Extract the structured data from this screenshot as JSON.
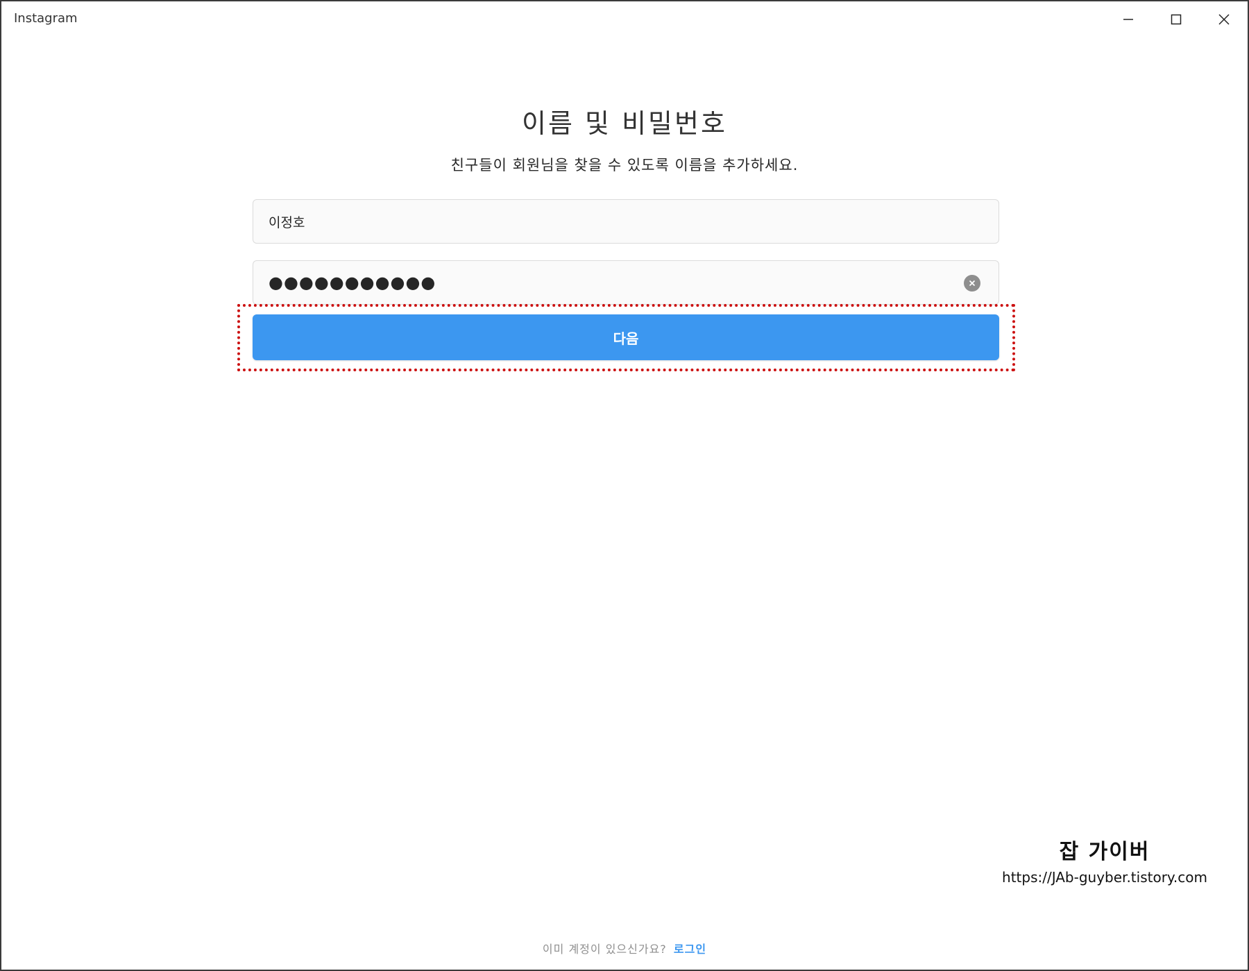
{
  "window": {
    "title": "Instagram",
    "controls": {
      "minimize": "minimize-icon",
      "maximize": "maximize-icon",
      "close": "close-icon"
    }
  },
  "form": {
    "heading": "이름 및 비밀번호",
    "subtext": "친구들이 회원님을 찾을 수 있도록 이름을 추가하세요.",
    "name_value": "이정호",
    "password_value": "●●●●●●●●●●●",
    "clear_icon": "clear-circle-icon",
    "next_label": "다음"
  },
  "footer": {
    "prompt": "이미 계정이 있으신가요?",
    "login_label": "로그인"
  },
  "watermark": {
    "name": "잡 가이버",
    "url": "https://JAb-guyber.tistory.com"
  },
  "colors": {
    "primary_button": "#3c97f0",
    "highlight_border": "#cc1111",
    "field_background": "#fafafa",
    "field_border": "#dbdbdb"
  }
}
